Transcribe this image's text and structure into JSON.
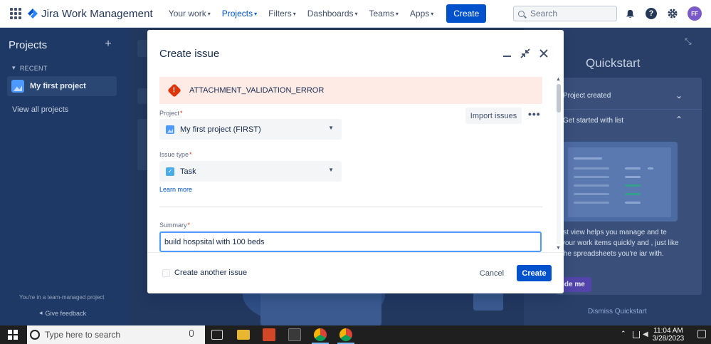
{
  "topnav": {
    "logo_text": "Jira Work Management",
    "items": [
      {
        "label": "Your work"
      },
      {
        "label": "Projects"
      },
      {
        "label": "Filters"
      },
      {
        "label": "Dashboards"
      },
      {
        "label": "Teams"
      },
      {
        "label": "Apps"
      }
    ],
    "create_label": "Create",
    "search_placeholder": "Search",
    "avatar_initials": "FF"
  },
  "sidebar": {
    "title": "Projects",
    "recent_label": "RECENT",
    "project_label": "My first project",
    "view_all": "View all projects",
    "team_managed_note": "You're in a team-managed project",
    "feedback": "Give feedback"
  },
  "quickstart": {
    "title": "Quickstart",
    "row1": "Project created",
    "row2": "Get started with list",
    "desc": "ist view helps you manage and te your work items quickly and , just like the spreadsheets you're iar with.",
    "guide_label": "ide me",
    "dismiss": "Dismiss Quickstart"
  },
  "modal": {
    "title": "Create issue",
    "error_text": "ATTACHMENT_VALIDATION_ERROR",
    "project_label": "Project",
    "project_value": "My first project (FIRST)",
    "import_label": "Import issues",
    "issue_type_label": "Issue type",
    "issue_type_value": "Task",
    "learn_more": "Learn more",
    "summary_label": "Summary",
    "summary_value": "build hospsital with 100 beds",
    "create_another": "Create another issue",
    "cancel": "Cancel",
    "create": "Create"
  },
  "taskbar": {
    "search_placeholder": "Type here to search",
    "time": "11:04 AM",
    "date": "3/28/2023"
  },
  "colors": {
    "brand_blue": "#0052cc",
    "error_red": "#de350b",
    "error_bg": "#ffebe6"
  }
}
